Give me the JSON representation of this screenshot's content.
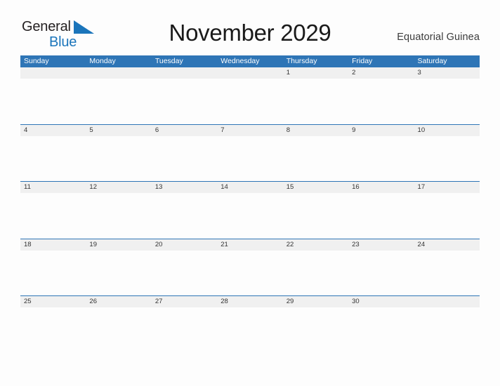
{
  "brand": {
    "name_part1": "General",
    "name_part2": "Blue",
    "flag_icon": "blue-triangle-flag-icon",
    "color_dark": "#231f20",
    "color_blue": "#1b75bb"
  },
  "header": {
    "title": "November 2029",
    "country": "Equatorial Guinea"
  },
  "theme": {
    "header_blue": "#2e75b6",
    "date_band_gray": "#f0f0f0",
    "rule_blue": "#2e75b6",
    "page_background": "#fdfdfd",
    "date_text": "#333333",
    "weekday_text": "#ffffff"
  },
  "calendar": {
    "month": "November",
    "year": "2029",
    "weekday_headers": [
      "Sunday",
      "Monday",
      "Tuesday",
      "Wednesday",
      "Thursday",
      "Friday",
      "Saturday"
    ],
    "weeks": [
      [
        "",
        "",
        "",
        "",
        "1",
        "2",
        "3"
      ],
      [
        "4",
        "5",
        "6",
        "7",
        "8",
        "9",
        "10"
      ],
      [
        "11",
        "12",
        "13",
        "14",
        "15",
        "16",
        "17"
      ],
      [
        "18",
        "19",
        "20",
        "21",
        "22",
        "23",
        "24"
      ],
      [
        "25",
        "26",
        "27",
        "28",
        "29",
        "30",
        ""
      ]
    ]
  }
}
